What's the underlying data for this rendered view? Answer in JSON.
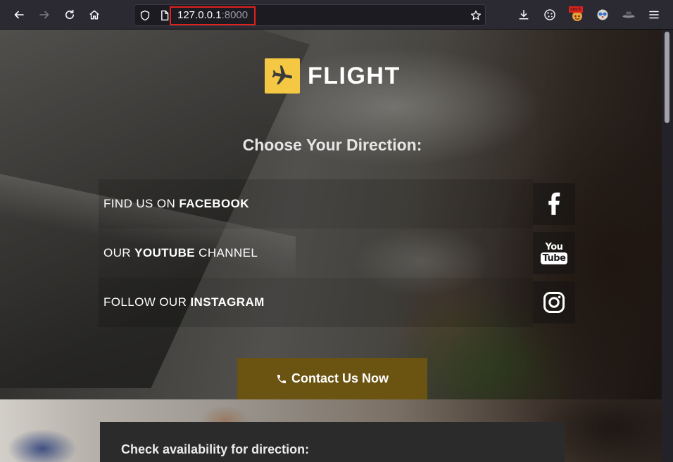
{
  "browser": {
    "nav": {
      "back_icon": "arrow-left-icon",
      "forward_icon": "arrow-right-icon",
      "reload_icon": "reload-icon",
      "home_icon": "home-icon"
    },
    "url": {
      "host": "127.0.0.1",
      "port": ":8000",
      "security_icon": "shield-icon",
      "page_icon": "page-icon",
      "bookmark_icon": "star-icon"
    },
    "toolbar_icons": [
      "download-icon",
      "cookie-extension-icon",
      "sock-extension-icon",
      "mask-extension-icon",
      "hat-extension-icon",
      "menu-icon"
    ],
    "extension_badge": "sock",
    "annotation_color": "#e0221c"
  },
  "page": {
    "logo": {
      "text": "FLIGHT",
      "icon": "airplane-icon",
      "accent": "#f5c843"
    },
    "heading": "Choose Your Direction:",
    "directions": [
      {
        "prefix": "FIND US ON ",
        "highlight": "FACEBOOK",
        "suffix": "",
        "icon": "facebook-icon"
      },
      {
        "prefix": "OUR ",
        "highlight": "YOUTUBE",
        "suffix": " CHANNEL",
        "icon": "youtube-icon"
      },
      {
        "prefix": "FOLLOW OUR ",
        "highlight": "INSTAGRAM",
        "suffix": "",
        "icon": "instagram-icon"
      }
    ],
    "youtube_logo": {
      "you": "You",
      "tube": "Tube"
    },
    "contact_button": {
      "label": "Contact Us Now",
      "icon": "phone-icon",
      "color": "#6b5311"
    },
    "availability_panel": {
      "title": "Check availability for direction:"
    }
  }
}
